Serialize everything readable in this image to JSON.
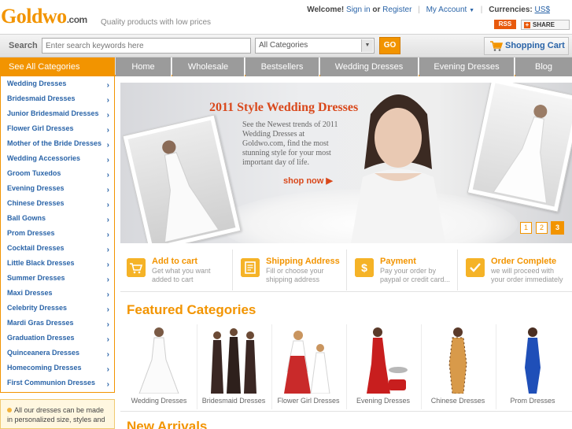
{
  "header": {
    "logo_main": "Goldwo",
    "logo_suffix": ".com",
    "tagline": "Quality products with low prices",
    "welcome": "Welcome!",
    "sign_in": "Sign in",
    "or": "or",
    "register": "Register",
    "my_account": "My Account",
    "currencies_label": "Currencies:",
    "currency": "US$",
    "rss": "RSS",
    "share": "SHARE"
  },
  "search": {
    "label": "Search",
    "placeholder": "Enter search keywords here",
    "category_selected": "All Categories",
    "go": "GO",
    "cart": "Shopping Cart"
  },
  "nav": {
    "all_categories": "See All Categories",
    "tabs": [
      "Home",
      "Wholesale",
      "Bestsellers",
      "Wedding Dresses",
      "Evening Dresses",
      "Blog"
    ]
  },
  "sidebar": {
    "items": [
      "Wedding Dresses",
      "Bridesmaid Dresses",
      "Junior Bridesmaid Dresses",
      "Flower Girl Dresses",
      "Mother of the Bride Dresses",
      "Wedding Accessories",
      "Groom Tuxedos",
      "Evening Dresses",
      "Chinese Dresses",
      "Ball Gowns",
      "Prom Dresses",
      "Cocktail Dresses",
      "Little Black Dresses",
      "Summer Dresses",
      "Maxi Dresses",
      "Celebrity Dresses",
      "Mardi Gras Dresses",
      "Graduation Dresses",
      "Quinceanera Dresses",
      "Homecoming Dresses",
      "First Communion Dresses"
    ],
    "note": "All our dresses can be made in personalized size, styles and"
  },
  "banner": {
    "title": "2011 Style Wedding Dresses",
    "text": "See the Newest trends of 2011 Wedding Dresses at Goldwo.com, find the most stunning style for your most important day of life.",
    "shop_now": "shop now",
    "pages": [
      "1",
      "2",
      "3"
    ],
    "active_page": "3"
  },
  "steps": [
    {
      "title": "Add to cart",
      "desc": "Get what you want added to cart",
      "icon": "cart-icon"
    },
    {
      "title": "Shipping Address",
      "desc": "Fill or choose your shipping address",
      "icon": "address-icon"
    },
    {
      "title": "Payment",
      "desc": "Pay your order by paypal or credit card...",
      "icon": "dollar-icon"
    },
    {
      "title": "Order Complete",
      "desc": "we will proceed with your order immediately",
      "icon": "checkmark-icon"
    }
  ],
  "featured": {
    "title": "Featured Categories",
    "items": [
      "Wedding Dresses",
      "Bridesmaid Dresses",
      "Flower Girl Dresses",
      "Evening Dresses",
      "Chinese Dresses",
      "Prom Dresses"
    ]
  },
  "new_arrivals": "New Arrivals",
  "colors": {
    "accent": "#f29400",
    "link": "#2a64a8",
    "nav_tab": "#9b9b9b",
    "banner_red": "#d9481b"
  }
}
